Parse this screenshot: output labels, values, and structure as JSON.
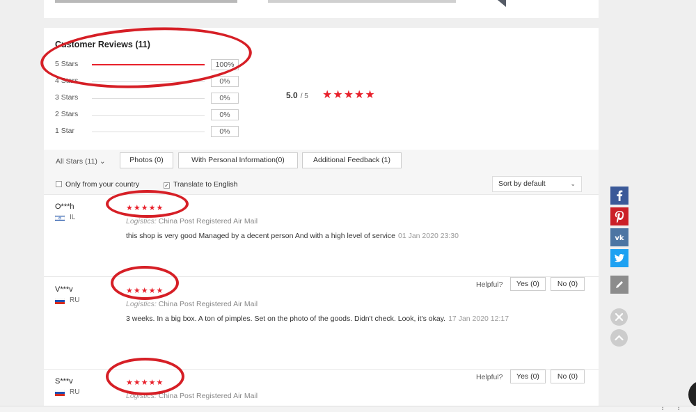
{
  "reviews_section": {
    "title": "Customer Reviews (11)",
    "histogram": [
      {
        "label": "5 Stars",
        "pct": "100%",
        "fill": 1.0
      },
      {
        "label": "4 Stars",
        "pct": "0%",
        "fill": 0
      },
      {
        "label": "3 Stars",
        "pct": "0%",
        "fill": 0
      },
      {
        "label": "2 Stars",
        "pct": "0%",
        "fill": 0
      },
      {
        "label": "1 Star",
        "pct": "0%",
        "fill": 0
      }
    ],
    "average": "5.0",
    "average_of": "/ 5",
    "average_stars": "★★★★★"
  },
  "filters": {
    "all_stars": "All Stars (11)",
    "photos": "Photos (0)",
    "personal_info": "With Personal Information(0)",
    "additional_feedback": "Additional Feedback (1)",
    "only_country": "Only from your country",
    "translate": "Translate to English",
    "sort": "Sort by default"
  },
  "reviews": [
    {
      "name": "O***h",
      "country": "IL",
      "stars": "★★★★★",
      "logistics_label": "Logistics:",
      "logistics": "China Post Registered Air Mail",
      "text": "this shop is very good Managed by a decent person And with a high level of service",
      "date": "01 Jan 2020 23:30"
    },
    {
      "name": "V***v",
      "country": "RU",
      "stars": "★★★★★",
      "logistics_label": "Logistics:",
      "logistics": "China Post Registered Air Mail",
      "text": "3 weeks. In a big box. A ton of pimples. Set on the photo of the goods. Didn't check. Look, it's okay.",
      "date": "17 Jan 2020 12:17"
    },
    {
      "name": "S***v",
      "country": "RU",
      "stars": "★★★★★",
      "logistics_label": "Logistics:",
      "logistics": "China Post Registered Air Mail"
    }
  ],
  "helpful": {
    "label": "Helpful?",
    "yes": "Yes (0)",
    "no": "No (0)"
  },
  "colors": {
    "accent": "#e8202b",
    "facebook": "#3b5998",
    "pinterest": "#cb2027",
    "vk": "#4c75a3",
    "twitter": "#1da1f2"
  },
  "side_icons": [
    "facebook-icon",
    "pinterest-icon",
    "vk-icon",
    "twitter-icon",
    "pencil-icon",
    "close-icon",
    "chevron-up-icon"
  ]
}
